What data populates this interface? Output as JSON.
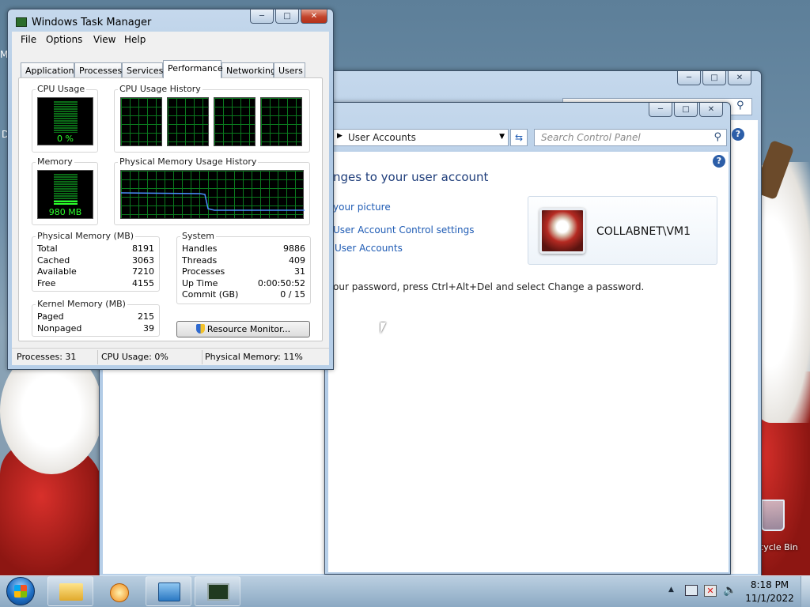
{
  "desktop": {
    "recycle_bin_label": "Recycle Bin",
    "edge_labels": [
      "M",
      "D"
    ]
  },
  "task_manager": {
    "title": "Windows Task Manager",
    "menu": [
      "File",
      "Options",
      "View",
      "Help"
    ],
    "tabs": [
      "Applications",
      "Processes",
      "Services",
      "Performance",
      "Networking",
      "Users"
    ],
    "active_tab": "Performance",
    "cpu_usage_title": "CPU Usage",
    "cpu_usage_value": "0 %",
    "cpu_history_title": "CPU Usage History",
    "memory_title": "Memory",
    "memory_value": "980 MB",
    "mem_history_title": "Physical Memory Usage History",
    "physical_memory": {
      "title": "Physical Memory (MB)",
      "rows": [
        {
          "label": "Total",
          "value": "8191"
        },
        {
          "label": "Cached",
          "value": "3063"
        },
        {
          "label": "Available",
          "value": "7210"
        },
        {
          "label": "Free",
          "value": "4155"
        }
      ]
    },
    "system": {
      "title": "System",
      "rows": [
        {
          "label": "Handles",
          "value": "9886"
        },
        {
          "label": "Threads",
          "value": "409"
        },
        {
          "label": "Processes",
          "value": "31"
        },
        {
          "label": "Up Time",
          "value": "0:00:50:52"
        },
        {
          "label": "Commit (GB)",
          "value": "0 / 15"
        }
      ]
    },
    "kernel_memory": {
      "title": "Kernel Memory (MB)",
      "rows": [
        {
          "label": "Paged",
          "value": "215"
        },
        {
          "label": "Nonpaged",
          "value": "39"
        }
      ]
    },
    "resource_monitor_button": "Resource Monitor...",
    "status": {
      "processes": "Processes: 31",
      "cpu": "CPU Usage: 0%",
      "memory": "Physical Memory: 11%"
    }
  },
  "control_panel": {
    "breadcrumb": "User Accounts",
    "search_placeholder": "Search Control Panel",
    "heading": "nges to your user account",
    "links": [
      "your picture",
      "User Account Control settings",
      "User Accounts"
    ],
    "password_note": "our password, press Ctrl+Alt+Del and select Change a password.",
    "user_name": "COLLABNET\\VM1"
  },
  "taskbar": {
    "time": "8:18 PM",
    "date": "11/1/2022"
  }
}
